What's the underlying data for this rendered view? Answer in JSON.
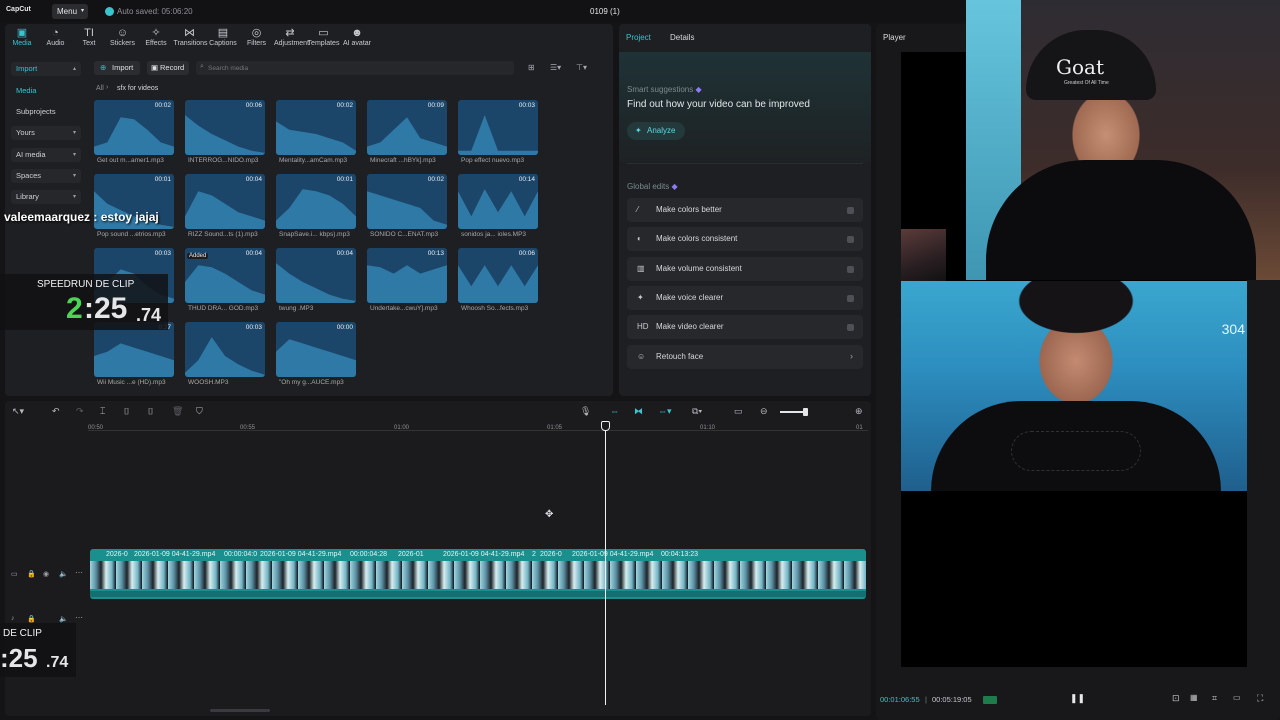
{
  "app": {
    "logo": "CapCut",
    "menu_label": "Menu",
    "autosave": "Auto saved: 05:06:20",
    "project_title": "0109 (1)"
  },
  "toolbar": [
    {
      "label": "Media",
      "icon": "media-icon",
      "glyph": "▣"
    },
    {
      "label": "Audio",
      "icon": "audio-icon",
      "glyph": "◔"
    },
    {
      "label": "Text",
      "icon": "text-icon",
      "glyph": "TI"
    },
    {
      "label": "Stickers",
      "icon": "stickers-icon",
      "glyph": "☺"
    },
    {
      "label": "Effects",
      "icon": "effects-icon",
      "glyph": "✧"
    },
    {
      "label": "Transitions",
      "icon": "transitions-icon",
      "glyph": "⋈"
    },
    {
      "label": "Captions",
      "icon": "captions-icon",
      "glyph": "▤"
    },
    {
      "label": "Filters",
      "icon": "filters-icon",
      "glyph": "◎"
    },
    {
      "label": "Adjustment",
      "icon": "adjustment-icon",
      "glyph": "⇄"
    },
    {
      "label": "Templates",
      "icon": "templates-icon",
      "glyph": "▭"
    },
    {
      "label": "AI avatar",
      "icon": "ai-avatar-icon",
      "glyph": "☻"
    }
  ],
  "sidebar": {
    "import": "Import",
    "media": "Media",
    "subprojects": "Subprojects",
    "yours": "Yours",
    "ai_media": "AI media",
    "spaces": "Spaces",
    "library": "Library"
  },
  "media_toolbar": {
    "import": "Import",
    "record": "Record",
    "search_placeholder": "Search media"
  },
  "breadcrumb": {
    "all": "All",
    "folder": "sfx for videos"
  },
  "media_items": [
    {
      "name": "Get out m...amer1.mp3",
      "duration": "00:02"
    },
    {
      "name": "INTERROG...NIDO.mp3",
      "duration": "00:06"
    },
    {
      "name": "Mentality...amCam.mp3",
      "duration": "00:02"
    },
    {
      "name": "Minecraft ...hBYk].mp3",
      "duration": "00:09"
    },
    {
      "name": "Pop effect nuevo.mp3",
      "duration": "00:03"
    },
    {
      "name": "Pop sound ...etrios.mp3",
      "duration": "00:01"
    },
    {
      "name": "RIZZ Sound...ts (1).mp3",
      "duration": "00:04"
    },
    {
      "name": "SnapSave.i... kbps).mp3",
      "duration": "00:01"
    },
    {
      "name": "SONIDO C...ENAT.mp3",
      "duration": "00:02"
    },
    {
      "name": "sonidos ja... ioles.MP3",
      "duration": "00:14"
    },
    {
      "name": "",
      "duration": "00:03"
    },
    {
      "name": "THUD DRA... GOD.mp3",
      "duration": "00:04",
      "badge": "Added"
    },
    {
      "name": "twung .MP3",
      "duration": "00:04"
    },
    {
      "name": "Undertake...cwuY].mp3",
      "duration": "00:13"
    },
    {
      "name": "Whoosh So...fects.mp3",
      "duration": "00:06"
    },
    {
      "name": "Wii Music ...e (HD).mp3",
      "duration": "0:27"
    },
    {
      "name": "WOOSH.MP3",
      "duration": "00:03"
    },
    {
      "name": "\"Oh my g...AUCE.mp3",
      "duration": "00:00"
    }
  ],
  "project_panel": {
    "tabs": [
      "Project",
      "Details"
    ],
    "smart_title": "Smart suggestions",
    "smart_desc": "Find out how your video can be improved",
    "analyze": "Analyze",
    "global_title": "Global edits",
    "edits": [
      {
        "label": "Make colors better",
        "icon": "magic-wand-icon",
        "glyph": "⁄"
      },
      {
        "label": "Make colors consistent",
        "icon": "palette-icon",
        "glyph": "◐"
      },
      {
        "label": "Make volume consistent",
        "icon": "volume-bars-icon",
        "glyph": "▥"
      },
      {
        "label": "Make voice clearer",
        "icon": "voice-enhance-icon",
        "glyph": "✦"
      },
      {
        "label": "Make video clearer",
        "icon": "hd-icon",
        "glyph": "HD"
      },
      {
        "label": "Retouch face",
        "icon": "retouch-face-icon",
        "glyph": "☺"
      }
    ]
  },
  "player": {
    "title": "Player",
    "current_time": "00:01:06:55",
    "total_time": "00:05:19:05"
  },
  "timeline": {
    "ruler": [
      "00:50",
      "00:55",
      "01:00",
      "01:05",
      "01:10",
      "01"
    ],
    "clips": [
      "2026-0",
      "2026-01-09 04-41-29.mp4",
      "00:00:04:0",
      "2026-01-09 04-41-29.mp4",
      "00:00:04:28",
      "2026-01",
      "2026-01-09 04-41-29.mp4",
      "2",
      "2026-0",
      "2026-01-09 04-41-29.mp4",
      "00:04:13:23"
    ]
  },
  "overlays": {
    "chat_user": "valeemaarquez",
    "chat_msg": " : estoy jajaj",
    "timer_title": "SPEEDRUN DE CLIP",
    "timer_min": "2",
    "timer_sec": ":25",
    "timer_ms": ".74",
    "timer2_title": "DE CLIP",
    "timer2_value": ":25",
    "timer2_ms": ".74",
    "webcam_cap_text": "Goat",
    "webcam_cap_subtext": "Greatest Of All Time",
    "side_number": "304"
  },
  "colors": {
    "accent": "#39c4d0",
    "tile": "#1c4669",
    "clip": "#1b8f8d",
    "bg": "#141416",
    "panel": "#1e1f22"
  }
}
